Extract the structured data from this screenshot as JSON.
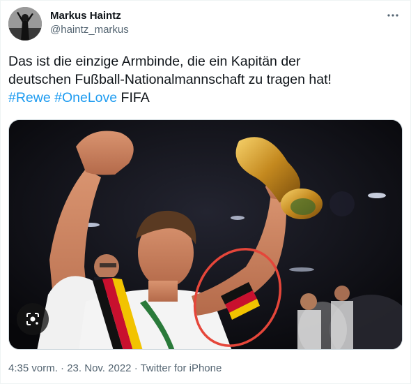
{
  "author": {
    "name": "Markus Haintz",
    "handle": "@haintz_markus"
  },
  "tweet": {
    "text_line1": "Das ist die einzige Armbinde, die ein Kapitän der",
    "text_line2": "deutschen Fußball-Nationalmannschaft zu tragen hat!",
    "hashtags": [
      "#Rewe",
      "#OneLove"
    ],
    "trailing_text": "FIFA"
  },
  "meta": {
    "time": "4:35 vorm.",
    "date": "23. Nov. 2022",
    "separator": "·",
    "source": "Twitter for iPhone"
  },
  "icons": {
    "more": "more-horizontal-icon",
    "lens": "google-lens-icon"
  },
  "colors": {
    "link": "#1d9bf0",
    "secondary_text": "#536471",
    "annotation_circle": "#e5463a"
  }
}
